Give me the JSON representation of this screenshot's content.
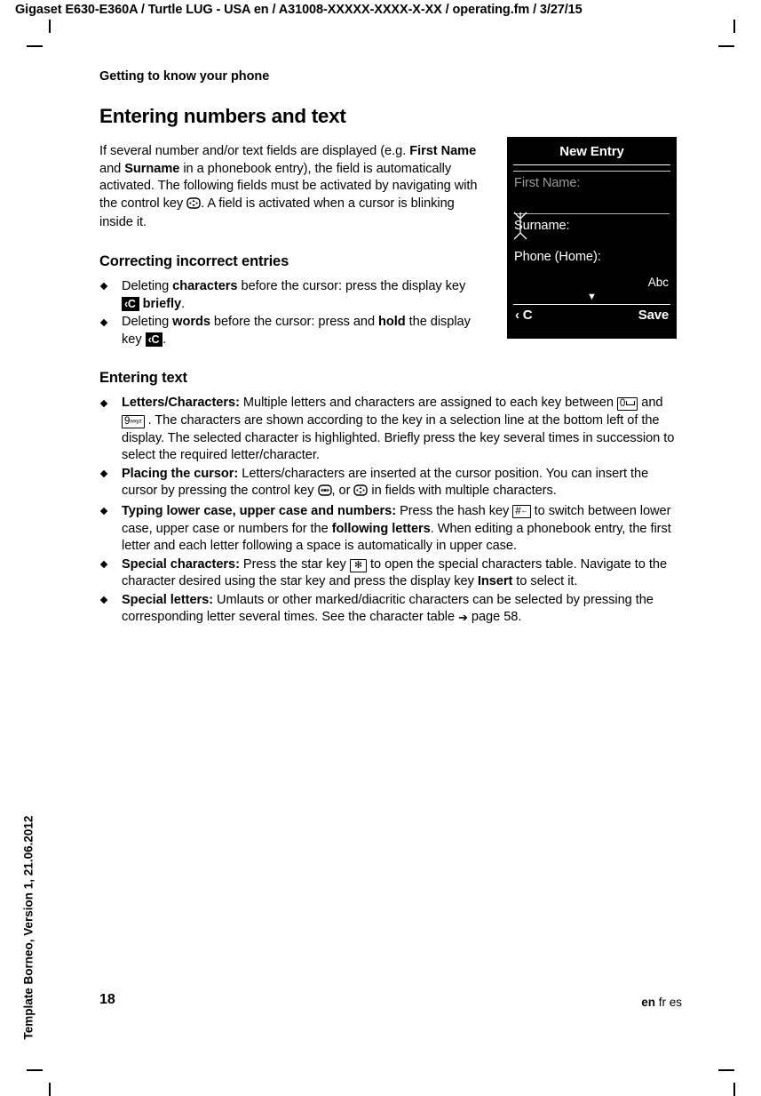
{
  "document": {
    "running_head": "Gigaset E630-E360A / Turtle LUG - USA en / A31008-XXXXX-XXXX-X-XX / operating.fm / 3/27/15",
    "template_note": "Template Borneo, Version 1, 21.06.2012",
    "page_number": "18",
    "languages": {
      "current": "en",
      "others": "fr es"
    }
  },
  "content": {
    "chapter_title": "Getting to know your phone",
    "section_title": "Entering numbers and text",
    "intro": {
      "part1": "If several number and/or text fields are displayed (e.g. ",
      "bold1": "First Name",
      "part2": " and ",
      "bold2": "Surname",
      "part3": " in a phonebook entry), the field is automatically activated. The following fields must be activated by navigating with the control key ",
      "part4": ". A field is activated when a cursor is blinking inside it."
    },
    "correcting": {
      "heading": "Correcting incorrect entries",
      "items": [
        {
          "part1": "Deleting ",
          "bold1": "characters",
          "part2": " before the cursor: press the display key ",
          "key": "‹C",
          "part3": " ",
          "bold2": "briefly",
          "part4": "."
        },
        {
          "part1": "Deleting ",
          "bold1": "words",
          "part2": " before the cursor: press and ",
          "bold2": "hold",
          "part3": " the display key ",
          "key": "‹C",
          "part4": "."
        }
      ]
    },
    "entering_text": {
      "heading": "Entering text",
      "items": [
        {
          "label": "Letters/Characters:",
          "part1": " Multiple letters and characters are assigned to each key between ",
          "key_a_digit": "0",
          "part2": " and ",
          "key_b_digit": "9",
          "key_b_letters": "wxyz",
          "part3": " . The characters are shown according to the key in a selection line at the bottom left of the display. The selected character is highlighted. Briefly press the key several times in succession to select the required letter/character."
        },
        {
          "label": "Placing the cursor:",
          "part1": " Letters/characters are inserted at the cursor position. You can insert the cursor by pressing the control key ",
          "part2": ", or ",
          "part3": " in fields with multiple characters."
        },
        {
          "label": "Typing lower case, upper case and numbers:",
          "part1": " Press the hash key ",
          "key_hash": "#",
          "part2": " to switch between lower case, upper case or numbers for the ",
          "bold1": "following letters",
          "part3": ". When editing a phonebook entry, the first letter and each letter following a space is automatically in upper case."
        },
        {
          "label": "Special characters:",
          "part1": " Press the star key ",
          "key_star": "✻",
          "part2": " to open the special characters table. Navigate to the character desired using the star key and press the display key ",
          "bold1": "Insert",
          "part3": " to select it."
        },
        {
          "label": "Special letters:",
          "part1": " Umlauts or other marked/diacritic characters can be selected by pressing the corresponding letter several times. See the character table ",
          "arrow": "➔",
          "part2": " page 58."
        }
      ]
    }
  },
  "handset_display": {
    "title": "New Entry",
    "fields": [
      {
        "label": "First Name:"
      },
      {
        "label": "Surname:"
      },
      {
        "label": "Phone (Home):"
      }
    ],
    "input_mode": "Abc",
    "scroll_indicator": "▼",
    "softkey_left": "‹ C",
    "softkey_right": "Save",
    "colors": {
      "background": "#000000",
      "text": "#ffffff",
      "dim_text": "#9a9a9a"
    }
  }
}
